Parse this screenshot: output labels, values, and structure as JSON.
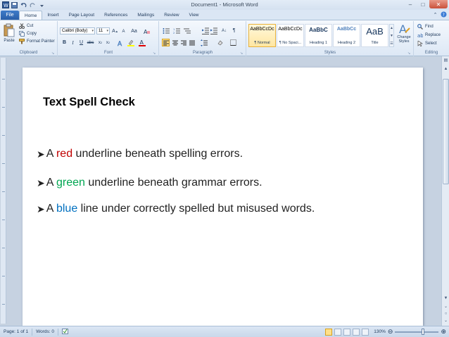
{
  "window": {
    "title": "Document1 - Microsoft Word"
  },
  "tabs": [
    {
      "label": "File"
    },
    {
      "label": "Home"
    },
    {
      "label": "Insert"
    },
    {
      "label": "Page Layout"
    },
    {
      "label": "References"
    },
    {
      "label": "Mailings"
    },
    {
      "label": "Review"
    },
    {
      "label": "View"
    }
  ],
  "ribbon": {
    "clipboard": {
      "paste": "Paste",
      "cut": "Cut",
      "copy": "Copy",
      "format_painter": "Format Painter",
      "label": "Clipboard"
    },
    "font": {
      "name": "Calibri (Body)",
      "size": "11",
      "label": "Font"
    },
    "paragraph": {
      "label": "Paragraph"
    },
    "styles": {
      "label": "Styles",
      "items": [
        {
          "sample": "AaBbCcDc",
          "name": "¶ Normal"
        },
        {
          "sample": "AaBbCcDc",
          "name": "¶ No Spaci..."
        },
        {
          "sample": "AaBbC",
          "name": "Heading 1"
        },
        {
          "sample": "AaBbCc",
          "name": "Heading 2"
        },
        {
          "sample": "AaB",
          "name": "Title"
        }
      ],
      "change_styles": "Change Styles"
    },
    "editing": {
      "find": "Find",
      "replace": "Replace",
      "select": "Select",
      "label": "Editing"
    }
  },
  "document": {
    "heading": "Text Spell Check",
    "bullets": [
      {
        "pre": "A ",
        "word": "red",
        "post": " underline beneath spelling errors."
      },
      {
        "pre": "A ",
        "word": "green",
        "post": " underline beneath grammar errors."
      },
      {
        "pre": "A ",
        "word": "blue",
        "post": " line under correctly spelled but misused words."
      }
    ]
  },
  "status": {
    "page": "Page: 1 of 1",
    "words": "Words: 0",
    "zoom": "130%"
  },
  "colors": {
    "red_word": "#c00000",
    "green_word": "#00a651",
    "blue_word": "#0070c0",
    "file_tab": "#2a5fa8"
  }
}
